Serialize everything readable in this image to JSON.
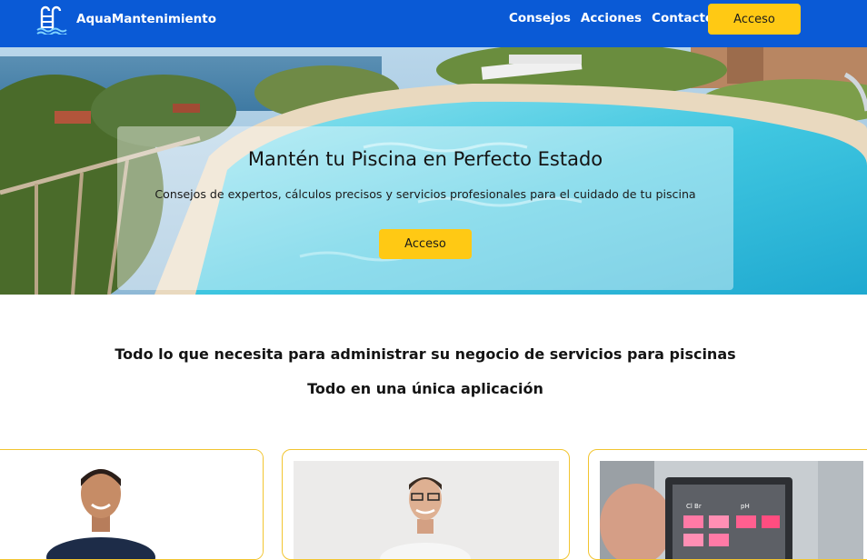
{
  "header": {
    "brand_name": "AquaMantenimiento",
    "nav": [
      "Consejos",
      "Acciones",
      "Contacto"
    ],
    "login_label": "Acceso"
  },
  "hero": {
    "title": "Mantén tu Piscina en Perfecto Estado",
    "subtitle": "Consejos de expertos, cálculos precisos y servicios profesionales para el cuidado de tu piscina",
    "cta_label": "Acceso"
  },
  "intro": {
    "line1": "Todo lo que necesita para administrar su negocio de servicios para piscinas",
    "line2": "Todo en una única aplicación"
  },
  "test_kit": {
    "labels": [
      "Cl Br",
      "pH"
    ]
  },
  "colors": {
    "header_bg": "#0a5ad6",
    "accent": "#ffc914",
    "card_border": "#f2c530"
  }
}
